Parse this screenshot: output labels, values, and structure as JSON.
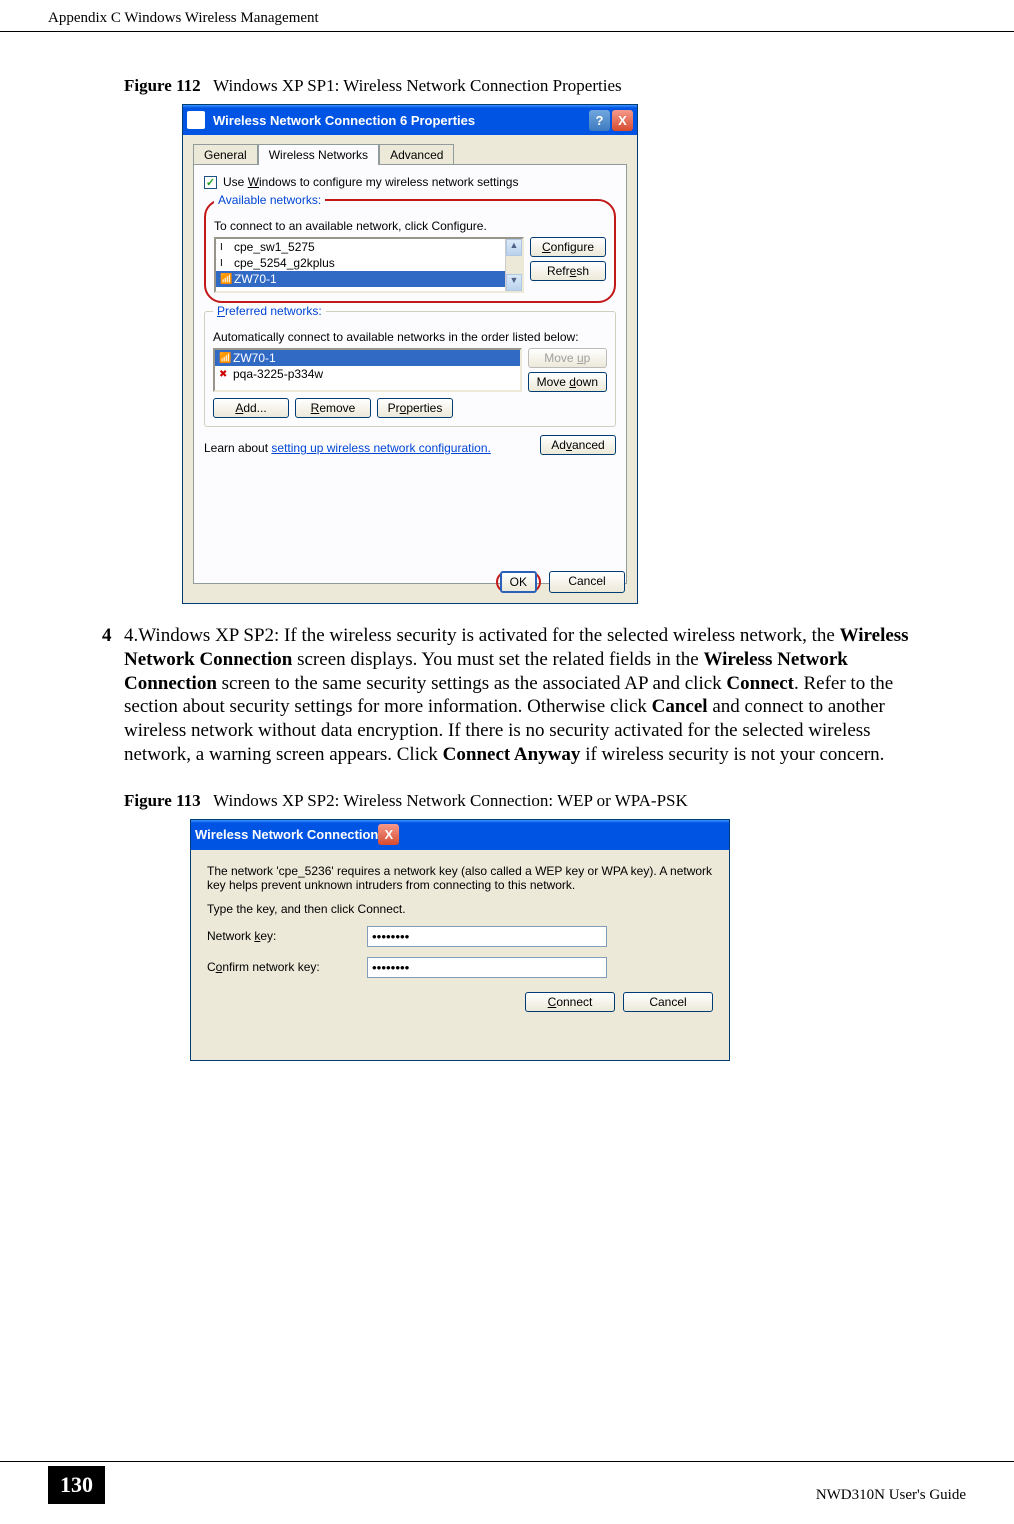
{
  "header": {
    "left": "Appendix C Windows Wireless Management"
  },
  "figure112": {
    "label": "Figure 112",
    "title": "Windows XP SP1: Wireless Network Connection Properties"
  },
  "screenshot1": {
    "window_title": "Wireless Network Connection 6 Properties",
    "tabs": {
      "general": "General",
      "wireless": "Wireless Networks",
      "advanced": "Advanced"
    },
    "checkbox": "Use Windows to configure my wireless network settings",
    "available": {
      "title": "Available networks:",
      "desc": "To connect to an available network, click Configure.",
      "items": [
        "cpe_sw1_5275",
        "cpe_5254_g2kplus",
        "ZW70-1"
      ],
      "configure": "Configure",
      "refresh": "Refresh"
    },
    "preferred": {
      "title": "Preferred networks:",
      "desc": "Automatically connect to available networks in the order listed below:",
      "items": [
        "ZW70-1",
        "pqa-3225-p334w"
      ],
      "moveup": "Move up",
      "movedown": "Move down",
      "add": "Add...",
      "remove": "Remove",
      "properties": "Properties"
    },
    "learn": {
      "text_prefix": "Learn about ",
      "link": "setting up wireless network configuration.",
      "advanced": "Advanced"
    },
    "ok": "OK",
    "cancel": "Cancel"
  },
  "paragraph": {
    "step": "4",
    "prefix": "4.Windows XP SP2: If the wireless security is activated for the selected wireless network, the ",
    "bold1": "Wireless Network Connection",
    "part2": " screen displays. You must set the related fields in the ",
    "bold2": "Wireless Network Connection",
    "part3": " screen to the same security settings as the associated AP and click ",
    "bold3": "Connect",
    "part4": ". Refer to the section about security settings for more information. Otherwise click ",
    "bold4": "Cancel",
    "part5": " and connect to another wireless network without data encryption. If there is no security activated for the selected wireless network, a warning screen appears. Click ",
    "bold5": "Connect Anyway",
    "part6": " if wireless security is not your concern."
  },
  "figure113": {
    "label": "Figure 113",
    "title": "Windows XP SP2: Wireless Network Connection: WEP or WPA-PSK"
  },
  "screenshot2": {
    "window_title": "Wireless Network Connection",
    "desc1": "The network 'cpe_5236' requires a network key (also called a WEP key or WPA key). A network key helps prevent unknown intruders from connecting to this network.",
    "desc2": "Type the key, and then click Connect.",
    "key_label": "Network key:",
    "confirm_label": "Confirm network key:",
    "key_value": "••••••••",
    "confirm_value": "••••••••",
    "connect": "Connect",
    "cancel": "Cancel"
  },
  "footer": {
    "page": "130",
    "guide": "NWD310N User's Guide"
  }
}
